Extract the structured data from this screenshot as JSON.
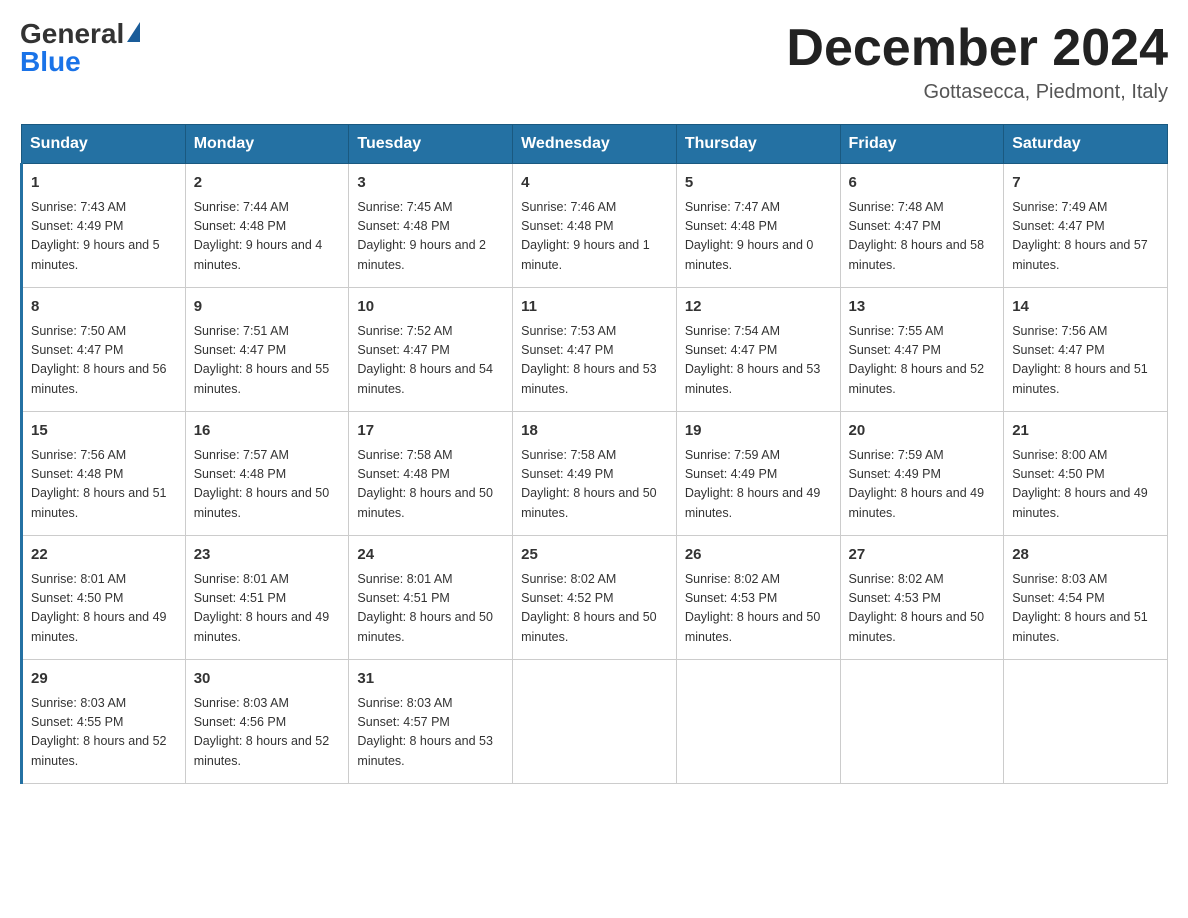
{
  "logo": {
    "general": "General",
    "blue": "Blue"
  },
  "header": {
    "month_year": "December 2024",
    "location": "Gottasecca, Piedmont, Italy"
  },
  "days_of_week": [
    "Sunday",
    "Monday",
    "Tuesday",
    "Wednesday",
    "Thursday",
    "Friday",
    "Saturday"
  ],
  "weeks": [
    [
      {
        "day": "1",
        "sunrise": "7:43 AM",
        "sunset": "4:49 PM",
        "daylight": "9 hours and 5 minutes."
      },
      {
        "day": "2",
        "sunrise": "7:44 AM",
        "sunset": "4:48 PM",
        "daylight": "9 hours and 4 minutes."
      },
      {
        "day": "3",
        "sunrise": "7:45 AM",
        "sunset": "4:48 PM",
        "daylight": "9 hours and 2 minutes."
      },
      {
        "day": "4",
        "sunrise": "7:46 AM",
        "sunset": "4:48 PM",
        "daylight": "9 hours and 1 minute."
      },
      {
        "day": "5",
        "sunrise": "7:47 AM",
        "sunset": "4:48 PM",
        "daylight": "9 hours and 0 minutes."
      },
      {
        "day": "6",
        "sunrise": "7:48 AM",
        "sunset": "4:47 PM",
        "daylight": "8 hours and 58 minutes."
      },
      {
        "day": "7",
        "sunrise": "7:49 AM",
        "sunset": "4:47 PM",
        "daylight": "8 hours and 57 minutes."
      }
    ],
    [
      {
        "day": "8",
        "sunrise": "7:50 AM",
        "sunset": "4:47 PM",
        "daylight": "8 hours and 56 minutes."
      },
      {
        "day": "9",
        "sunrise": "7:51 AM",
        "sunset": "4:47 PM",
        "daylight": "8 hours and 55 minutes."
      },
      {
        "day": "10",
        "sunrise": "7:52 AM",
        "sunset": "4:47 PM",
        "daylight": "8 hours and 54 minutes."
      },
      {
        "day": "11",
        "sunrise": "7:53 AM",
        "sunset": "4:47 PM",
        "daylight": "8 hours and 53 minutes."
      },
      {
        "day": "12",
        "sunrise": "7:54 AM",
        "sunset": "4:47 PM",
        "daylight": "8 hours and 53 minutes."
      },
      {
        "day": "13",
        "sunrise": "7:55 AM",
        "sunset": "4:47 PM",
        "daylight": "8 hours and 52 minutes."
      },
      {
        "day": "14",
        "sunrise": "7:56 AM",
        "sunset": "4:47 PM",
        "daylight": "8 hours and 51 minutes."
      }
    ],
    [
      {
        "day": "15",
        "sunrise": "7:56 AM",
        "sunset": "4:48 PM",
        "daylight": "8 hours and 51 minutes."
      },
      {
        "day": "16",
        "sunrise": "7:57 AM",
        "sunset": "4:48 PM",
        "daylight": "8 hours and 50 minutes."
      },
      {
        "day": "17",
        "sunrise": "7:58 AM",
        "sunset": "4:48 PM",
        "daylight": "8 hours and 50 minutes."
      },
      {
        "day": "18",
        "sunrise": "7:58 AM",
        "sunset": "4:49 PM",
        "daylight": "8 hours and 50 minutes."
      },
      {
        "day": "19",
        "sunrise": "7:59 AM",
        "sunset": "4:49 PM",
        "daylight": "8 hours and 49 minutes."
      },
      {
        "day": "20",
        "sunrise": "7:59 AM",
        "sunset": "4:49 PM",
        "daylight": "8 hours and 49 minutes."
      },
      {
        "day": "21",
        "sunrise": "8:00 AM",
        "sunset": "4:50 PM",
        "daylight": "8 hours and 49 minutes."
      }
    ],
    [
      {
        "day": "22",
        "sunrise": "8:01 AM",
        "sunset": "4:50 PM",
        "daylight": "8 hours and 49 minutes."
      },
      {
        "day": "23",
        "sunrise": "8:01 AM",
        "sunset": "4:51 PM",
        "daylight": "8 hours and 49 minutes."
      },
      {
        "day": "24",
        "sunrise": "8:01 AM",
        "sunset": "4:51 PM",
        "daylight": "8 hours and 50 minutes."
      },
      {
        "day": "25",
        "sunrise": "8:02 AM",
        "sunset": "4:52 PM",
        "daylight": "8 hours and 50 minutes."
      },
      {
        "day": "26",
        "sunrise": "8:02 AM",
        "sunset": "4:53 PM",
        "daylight": "8 hours and 50 minutes."
      },
      {
        "day": "27",
        "sunrise": "8:02 AM",
        "sunset": "4:53 PM",
        "daylight": "8 hours and 50 minutes."
      },
      {
        "day": "28",
        "sunrise": "8:03 AM",
        "sunset": "4:54 PM",
        "daylight": "8 hours and 51 minutes."
      }
    ],
    [
      {
        "day": "29",
        "sunrise": "8:03 AM",
        "sunset": "4:55 PM",
        "daylight": "8 hours and 52 minutes."
      },
      {
        "day": "30",
        "sunrise": "8:03 AM",
        "sunset": "4:56 PM",
        "daylight": "8 hours and 52 minutes."
      },
      {
        "day": "31",
        "sunrise": "8:03 AM",
        "sunset": "4:57 PM",
        "daylight": "8 hours and 53 minutes."
      },
      null,
      null,
      null,
      null
    ]
  ]
}
